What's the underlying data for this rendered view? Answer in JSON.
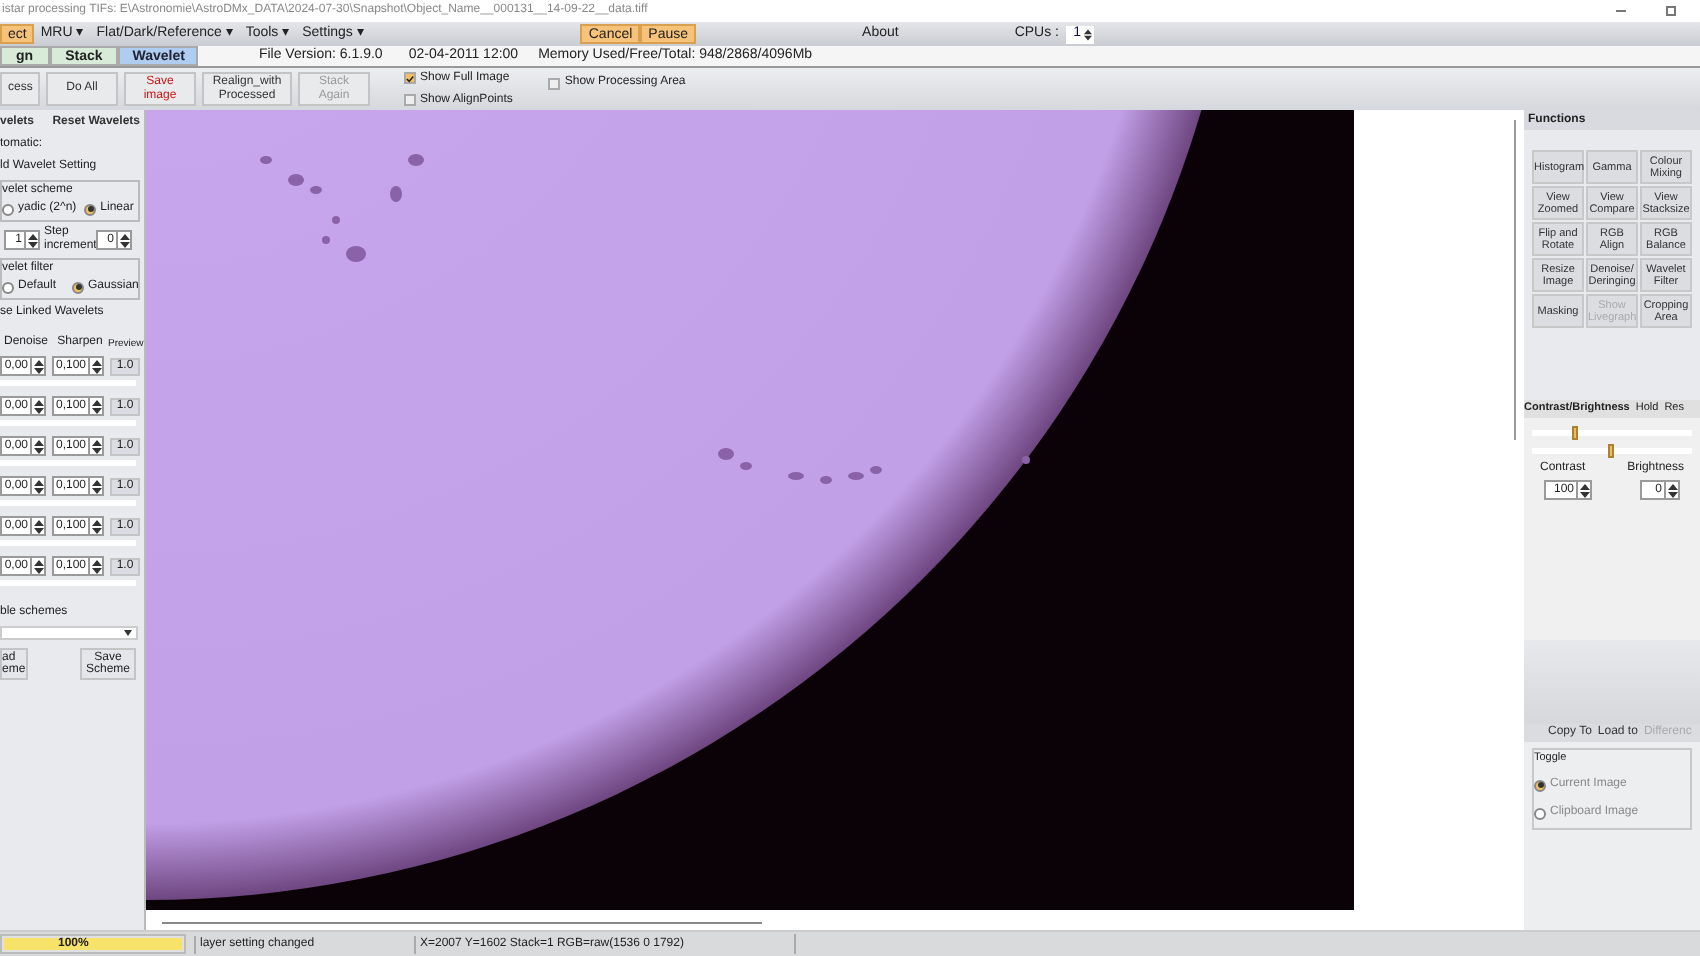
{
  "window": {
    "title": "istar processing TIFs: E\\Astronomie\\AstroDMx_DATA\\2024-07-30\\Snapshot\\Object_Name__000131__14-09-22__data.tiff"
  },
  "menu": [
    {
      "label": "ect",
      "kind": "highlight"
    },
    {
      "label": "MRU ▾",
      "kind": "plain"
    },
    {
      "label": "Flat/Dark/Reference ▾",
      "kind": "plain"
    },
    {
      "label": "Tools ▾",
      "kind": "plain"
    },
    {
      "label": "Settings ▾",
      "kind": "plain"
    },
    {
      "label": "Cancel",
      "kind": "highlight"
    },
    {
      "label": "Pause",
      "kind": "highlight"
    },
    {
      "label": "About",
      "kind": "plain"
    }
  ],
  "cpus": {
    "label": "CPUs :",
    "value": "1"
  },
  "tabs": [
    {
      "label": "gn",
      "selected": false
    },
    {
      "label": "Stack",
      "selected": false
    },
    {
      "label": "Wavelet",
      "selected": true
    }
  ],
  "info": [
    "File Version: 6.1.9.0",
    "02-04-2011 12:00",
    "Memory Used/Free/Total: 948/2868/4096Mb"
  ],
  "toolbar": [
    {
      "label": "cess",
      "kind": "normal"
    },
    {
      "label": "Do All",
      "kind": "normal"
    },
    {
      "label": "Save image",
      "kind": "warning"
    },
    {
      "label": "Realign_with Processed",
      "kind": "normal"
    },
    {
      "label": "Stack Again",
      "kind": "disabled"
    }
  ],
  "options": [
    {
      "label": "Show Full Image",
      "checked": true
    },
    {
      "label": "Show AlignPoints",
      "checked": false
    },
    {
      "label": "Show Processing Area",
      "checked": false
    }
  ],
  "wavelets": {
    "title": "velets",
    "reset": "Reset Wavelets",
    "automatic": "tomatic:",
    "hold": "ld Wavelet Setting",
    "scheme_title": "velet scheme",
    "scheme": [
      {
        "label": "yadic (2^n)",
        "selected": false
      },
      {
        "label": "Linear",
        "selected": true
      }
    ],
    "layer": "1",
    "step_label": "Step increment",
    "step": "0",
    "filter_title": "velet filter",
    "filter": [
      {
        "label": "Default",
        "selected": false
      },
      {
        "label": "Gaussian",
        "selected": true
      }
    ],
    "linked": "se Linked Wavelets",
    "columns": [
      "Denoise",
      "Sharpen",
      "Preview"
    ],
    "rows": [
      {
        "denoise": "0,00",
        "sharpen": "0,100",
        "preview": "1.0"
      },
      {
        "denoise": "0,00",
        "sharpen": "0,100",
        "preview": "1.0"
      },
      {
        "denoise": "0,00",
        "sharpen": "0,100",
        "preview": "1.0"
      },
      {
        "denoise": "0,00",
        "sharpen": "0,100",
        "preview": "1.0"
      },
      {
        "denoise": "0,00",
        "sharpen": "0,100",
        "preview": "1.0"
      },
      {
        "denoise": "0,00",
        "sharpen": "0,100",
        "preview": "1.0"
      }
    ],
    "schemes_label": "ble schemes",
    "load": "ad\neme",
    "save": "Save Scheme"
  },
  "functions": {
    "title": "Functions",
    "buttons": [
      {
        "label": "Histogram",
        "disabled": false
      },
      {
        "label": "Gamma",
        "disabled": false
      },
      {
        "label": "Colour Mixing",
        "disabled": false
      },
      {
        "label": "View Zoomed",
        "disabled": false
      },
      {
        "label": "View Compare",
        "disabled": false
      },
      {
        "label": "View Stacksize",
        "disabled": false
      },
      {
        "label": "Flip and Rotate",
        "disabled": false
      },
      {
        "label": "RGB Align",
        "disabled": false
      },
      {
        "label": "RGB Balance",
        "disabled": false
      },
      {
        "label": "Resize Image",
        "disabled": false
      },
      {
        "label": "Denoise/ Deringing",
        "disabled": false
      },
      {
        "label": "Wavelet Filter",
        "disabled": false
      },
      {
        "label": "Masking",
        "disabled": false
      },
      {
        "label": "Show Livegraph",
        "disabled": true
      },
      {
        "label": "Cropping Area",
        "disabled": false
      }
    ]
  },
  "contrast": {
    "title": "Contrast/Brightness",
    "hold": "Hold",
    "reset": "Res",
    "sliders": [
      {
        "level": 0.27
      },
      {
        "level": 0.5
      }
    ],
    "contrast_label": "Contrast",
    "contrast": "100",
    "brightness_label": "Brightness",
    "brightness": "0"
  },
  "copy_tabs": [
    {
      "label": "Copy To",
      "disabled": false
    },
    {
      "label": "Load to",
      "disabled": false
    },
    {
      "label": "Differenc",
      "disabled": true
    }
  ],
  "toggle": {
    "title": "Toggle",
    "options": [
      {
        "label": "Current Image",
        "selected": true
      },
      {
        "label": "Clipboard Image",
        "selected": false
      }
    ]
  },
  "status": {
    "progress": {
      "label": "100%",
      "level": 1
    },
    "message": "layer setting changed",
    "pixel": "X=2007 Y=1602 Stack=1 RGB=raw(1536 0 1792)"
  }
}
